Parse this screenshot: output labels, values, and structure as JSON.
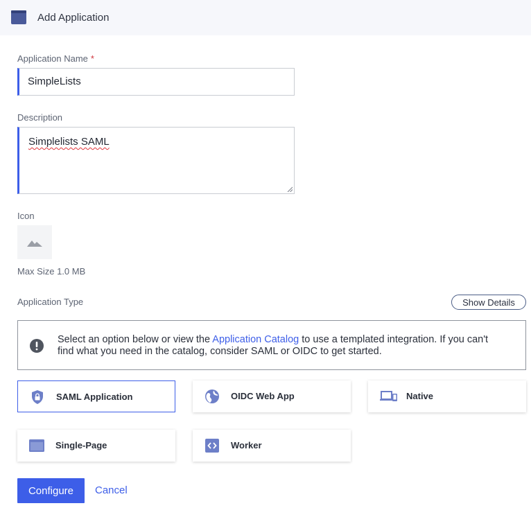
{
  "header": {
    "title": "Add Application",
    "icon": "window-icon"
  },
  "form": {
    "name_label": "Application Name",
    "required_mark": "*",
    "name_value": "SimpleLists",
    "description_label": "Description",
    "description_value": "Simplelists SAML",
    "icon_label": "Icon",
    "icon_placeholder": "image-placeholder-icon",
    "max_size": "Max Size 1.0 MB",
    "app_type_label": "Application Type",
    "show_details": "Show Details"
  },
  "notice": {
    "icon": "alert-icon",
    "text_before": "Select an option below or view the ",
    "link": "Application Catalog",
    "text_after": " to use a templated integration. If you can't find what you need in the catalog, consider SAML or OIDC to get started."
  },
  "app_types": [
    {
      "label": "SAML Application",
      "icon": "shield-lock-icon",
      "selected": true
    },
    {
      "label": "OIDC Web App",
      "icon": "globe-icon",
      "selected": false
    },
    {
      "label": "Native",
      "icon": "devices-icon",
      "selected": false
    },
    {
      "label": "Single-Page",
      "icon": "browser-window-icon",
      "selected": false
    },
    {
      "label": "Worker",
      "icon": "code-icon",
      "selected": false
    }
  ],
  "actions": {
    "configure": "Configure",
    "cancel": "Cancel"
  },
  "colors": {
    "accent": "#3d5ee8",
    "icon": "#6d7fc8",
    "header_bg": "#f6f7fb"
  }
}
